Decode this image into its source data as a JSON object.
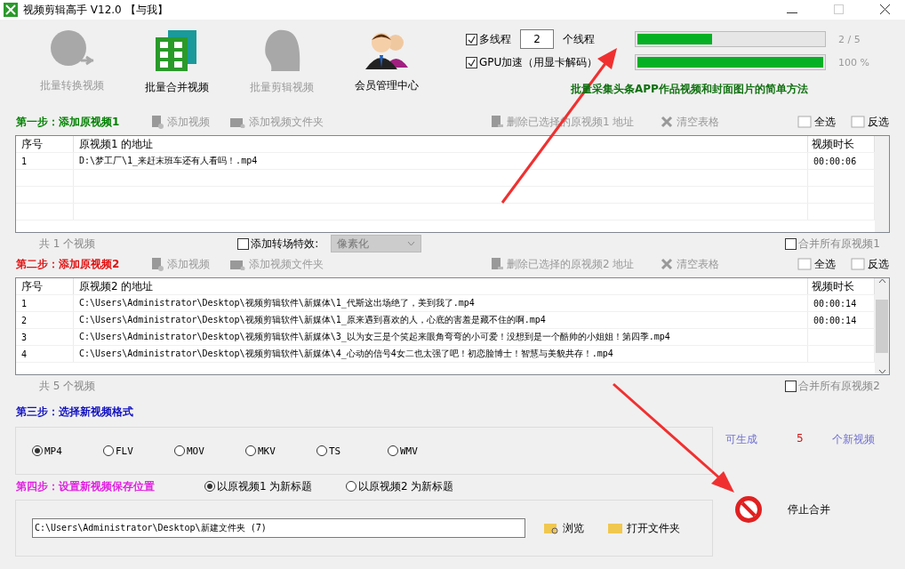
{
  "window": {
    "title": "视频剪辑高手 V12.0 【与我】"
  },
  "toolbar": [
    {
      "kind": "convert",
      "label": "批量转换视频",
      "disabled": true
    },
    {
      "kind": "merge",
      "label": "批量合并视频",
      "disabled": false
    },
    {
      "kind": "edit",
      "label": "批量剪辑视频",
      "disabled": true
    },
    {
      "kind": "members",
      "label": "会员管理中心",
      "disabled": false
    }
  ],
  "options": {
    "multithread": {
      "label": "多线程",
      "checked": true,
      "value": "2",
      "suffix": "个线程"
    },
    "gpu": {
      "label": "GPU加速（用显卡解码）",
      "checked": true
    }
  },
  "progress": [
    {
      "level": 0.4,
      "reading": "2 / 5"
    },
    {
      "level": 1,
      "reading": "100 %"
    }
  ],
  "banner": "批量采集头条APP作品视频和封面图片的简单方法",
  "steps": [
    {
      "title": "第一步：添加原视频1",
      "color": "#008000",
      "actions": [
        {
          "kind": "file",
          "label": "添加视频"
        },
        {
          "kind": "folder",
          "label": "添加视频文件夹"
        },
        {
          "kind": "delete",
          "label": "删除已选择的原视频1 地址"
        },
        {
          "kind": "clear",
          "label": "清空表格"
        }
      ],
      "select_all": "全选",
      "invert": "反选",
      "columns": [
        "序号",
        "原视频1 的地址",
        "视频时长"
      ],
      "rows": [
        [
          "1",
          "D:\\梦工厂\\1_来赶末班车还有人看吗！.mp4",
          "00:00:06"
        ]
      ],
      "count": "共 1 个视频",
      "transition": {
        "label": "添加转场特效:",
        "checked": false,
        "value": "像素化"
      },
      "merge_all": {
        "label": "合并所有原视频1",
        "checked": false
      }
    },
    {
      "title": "第二步：添加原视频2",
      "color": "#e01010",
      "actions": [
        {
          "kind": "file",
          "label": "添加视频"
        },
        {
          "kind": "folder",
          "label": "添加视频文件夹"
        },
        {
          "kind": "delete",
          "label": "删除已选择的原视频2 地址"
        },
        {
          "kind": "clear",
          "label": "清空表格"
        }
      ],
      "select_all": "全选",
      "invert": "反选",
      "columns": [
        "序号",
        "原视频2 的地址",
        "视频时长"
      ],
      "rows": [
        [
          "1",
          "C:\\Users\\Administrator\\Desktop\\视频剪辑软件\\新媒体\\1_代斯这出场绝了，美到我了.mp4",
          "00:00:14"
        ],
        [
          "2",
          "C:\\Users\\Administrator\\Desktop\\视频剪辑软件\\新媒体\\1_原来遇到喜欢的人，心底的害羞是藏不住的啊.mp4",
          "00:00:14"
        ],
        [
          "3",
          "C:\\Users\\Administrator\\Desktop\\视频剪辑软件\\新媒体\\3_以为女三是个笑起来眼角弯弯的小可爱！没想到是一个酷帅的小姐姐！第四季.mp4",
          ""
        ],
        [
          "4",
          "C:\\Users\\Administrator\\Desktop\\视频剪辑软件\\新媒体\\4_心动的信号4女二也太强了吧！初恋脸博士！智慧与美貌共存！.mp4",
          ""
        ]
      ],
      "count": "共 5 个视频",
      "merge_all": {
        "label": "合并所有原视频2",
        "checked": false
      }
    }
  ],
  "format": {
    "title": "第三步：选择新视频格式",
    "color": "#1010c0",
    "options": [
      {
        "label": "MP4",
        "selected": true
      },
      {
        "label": "FLV",
        "selected": false
      },
      {
        "label": "MOV",
        "selected": false
      },
      {
        "label": "MKV",
        "selected": false
      },
      {
        "label": "TS",
        "selected": false
      },
      {
        "label": "WMV",
        "selected": false
      }
    ]
  },
  "summary": {
    "prefix": "可生成",
    "count": "5",
    "suffix": "个新视频"
  },
  "output": {
    "title": "第四步：设置新视频保存位置",
    "color": "#e020e0",
    "naming": [
      {
        "label": "以原视频1 为新标题",
        "selected": true
      },
      {
        "label": "以原视频2 为新标题",
        "selected": false
      }
    ],
    "path": "C:\\Users\\Administrator\\Desktop\\新建文件夹 (7)",
    "browse": "浏览",
    "open_folder": "打开文件夹"
  },
  "stop": "停止合并"
}
